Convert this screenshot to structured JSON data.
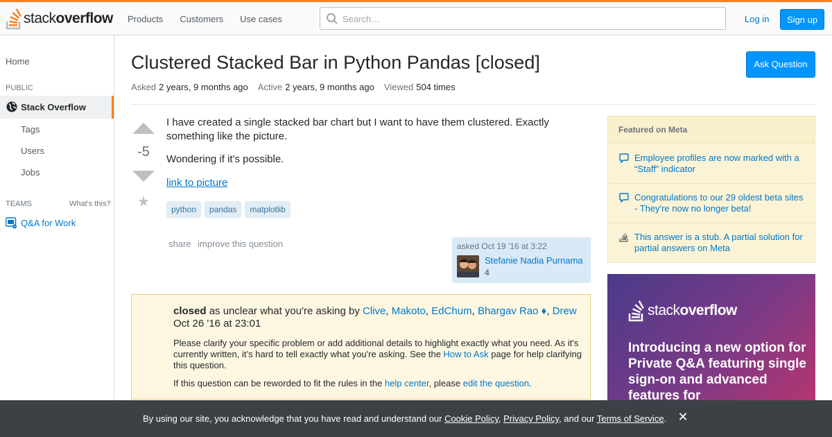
{
  "header": {
    "logo_text_light": "stack",
    "logo_text_bold": "overflow",
    "nav": [
      "Products",
      "Customers",
      "Use cases"
    ],
    "search_placeholder": "Search…",
    "login_label": "Log in",
    "signup_label": "Sign up",
    "accent_color": "#f48024",
    "primary_button_color": "#0095ff"
  },
  "sidebar": {
    "home": "Home",
    "public_heading": "PUBLIC",
    "active_item": "Stack Overflow",
    "sub_items": [
      "Tags",
      "Users",
      "Jobs"
    ],
    "teams_heading": "TEAMS",
    "whats_this": "What's this?",
    "qa_for_work": "Q&A for Work"
  },
  "question": {
    "title": "Clustered Stacked Bar in Python Pandas [closed]",
    "ask_button": "Ask Question",
    "asked_label": "Asked",
    "asked_value": "2 years, 9 months ago",
    "active_label": "Active",
    "active_value": "2 years, 9 months ago",
    "viewed_label": "Viewed",
    "viewed_value": "504 times",
    "vote_count": "-5",
    "body_p1": "I have created a single stacked bar chart but I want to have them clustered. Exactly something like the picture.",
    "body_p2": "Wondering if it's possible.",
    "link_text": "link to picture",
    "tags": [
      "python",
      "pandas",
      "matplotlib"
    ],
    "menu": [
      "share",
      "improve this question"
    ],
    "user_card": {
      "asked_text": "asked Oct 19 '16 at 3:22",
      "name": "Stefanie Nadia Purnama",
      "reputation": "4"
    }
  },
  "closed_notice": {
    "closed_word": "closed",
    "reason": " as unclear what you're asking by ",
    "voters": [
      "Clive",
      "Makoto",
      "EdChum",
      "Bhargav Rao ♦",
      "Drew"
    ],
    "sep1": ", ",
    "sep2": ", ",
    "sep3": ", ",
    "sep4": ", ",
    "date": "Oct 26 '16 at 23:01",
    "p1_before": "Please clarify your specific problem or add additional details to highlight exactly what you need. As it's currently written, it’s hard to tell exactly what you're asking. See the ",
    "p1_link": "How to Ask",
    "p1_after": " page for help clarifying this question.",
    "p2_before": "If this question can be reworded to fit the rules in the ",
    "p2_link1": "help center",
    "p2_middle": ", please ",
    "p2_link2": "edit the question",
    "p2_after": "."
  },
  "featured_meta": {
    "heading": "Featured on Meta",
    "items": [
      {
        "text": "Employee profiles are now marked with a “Staff” indicator",
        "icon": "speech-bubble-icon"
      },
      {
        "text": "Congratulations to our 29 oldest beta sites - They're now no longer beta!",
        "icon": "speech-bubble-icon"
      },
      {
        "text": "This answer is a stub. A partial solution for partial answers on Meta",
        "icon": "stack-exchange-icon"
      }
    ]
  },
  "ad": {
    "logo_light": "stack",
    "logo_bold": "overflow",
    "text": "Introducing a new option for Private Q&A featuring single sign-on and advanced features for"
  },
  "cookie_bar": {
    "before": "By using our site, you acknowledge that you have read and understand our ",
    "link1": "Cookie Policy",
    "sep1": ", ",
    "link2": "Privacy Policy",
    "middle": ", and our ",
    "link3": "Terms of Service",
    "after": ".",
    "close": "✕"
  }
}
